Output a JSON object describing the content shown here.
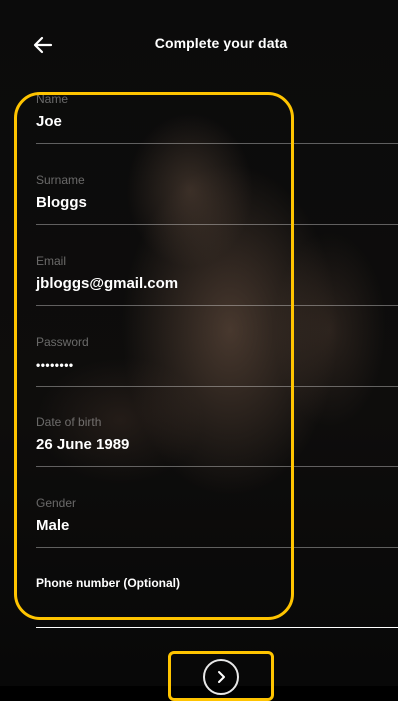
{
  "header": {
    "title": "Complete your data"
  },
  "form": {
    "name": {
      "label": "Name",
      "value": "Joe"
    },
    "surname": {
      "label": "Surname",
      "value": "Bloggs"
    },
    "email": {
      "label": "Email",
      "value": "jbloggs@gmail.com"
    },
    "password": {
      "label": "Password",
      "value": "••••••••"
    },
    "date_of_birth": {
      "label": "Date of birth",
      "value": "26 June 1989"
    },
    "gender": {
      "label": "Gender",
      "value": "Male"
    },
    "phone": {
      "label": "Phone number (Optional)",
      "value": ""
    }
  },
  "icons": {
    "back": "arrow-left-icon",
    "next": "chevron-right-icon"
  },
  "colors": {
    "highlight": "#ffc400",
    "label": "#8a8a8a",
    "text": "#ffffff",
    "background": "#000000"
  }
}
